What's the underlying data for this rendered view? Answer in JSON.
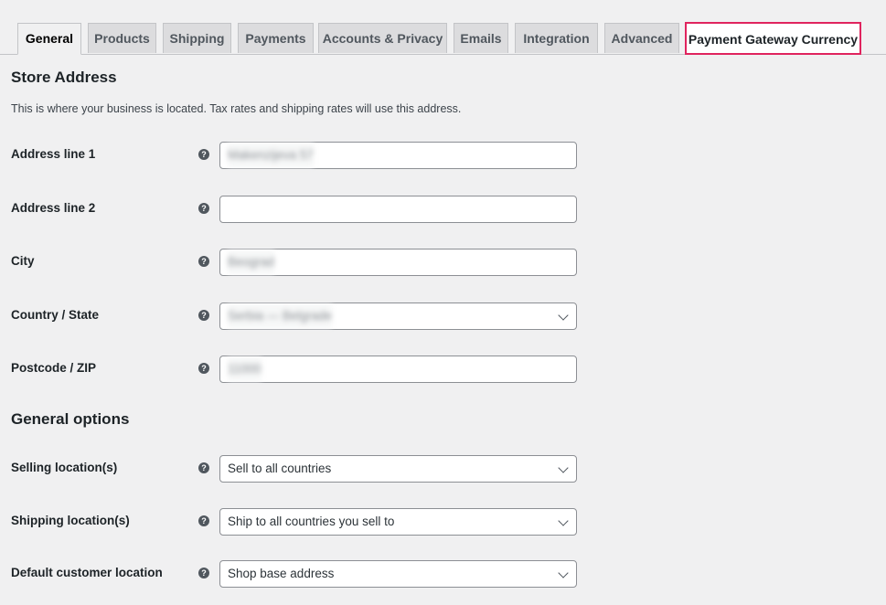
{
  "tabs": [
    {
      "label": "General",
      "state": "active"
    },
    {
      "label": "Products",
      "state": ""
    },
    {
      "label": "Shipping",
      "state": ""
    },
    {
      "label": "Payments",
      "state": ""
    },
    {
      "label": "Accounts & Privacy",
      "state": ""
    },
    {
      "label": "Emails",
      "state": ""
    },
    {
      "label": "Integration",
      "state": ""
    },
    {
      "label": "Advanced",
      "state": ""
    },
    {
      "label": "Payment Gateway Currency",
      "state": "highlighted"
    }
  ],
  "highlight_color": "#e0245e",
  "store_address": {
    "title": "Store Address",
    "description": "This is where your business is located. Tax rates and shipping rates will use this address.",
    "fields": [
      {
        "label": "Address line 1",
        "value": "Makenzijeva 57",
        "type": "text",
        "blurred": true
      },
      {
        "label": "Address line 2",
        "value": "",
        "type": "text",
        "blurred": false
      },
      {
        "label": "City",
        "value": "Beograd",
        "type": "text",
        "blurred": true
      },
      {
        "label": "Country / State",
        "value": "Serbia — Belgrade",
        "type": "select",
        "blurred": true
      },
      {
        "label": "Postcode / ZIP",
        "value": "11000",
        "type": "text",
        "blurred": true
      }
    ]
  },
  "general_options": {
    "title": "General options",
    "fields": [
      {
        "label": "Selling location(s)",
        "value": "Sell to all countries",
        "type": "select"
      },
      {
        "label": "Shipping location(s)",
        "value": "Ship to all countries you sell to",
        "type": "select"
      },
      {
        "label": "Default customer location",
        "value": "Shop base address",
        "type": "select"
      }
    ]
  },
  "help_icon_glyph": "?"
}
